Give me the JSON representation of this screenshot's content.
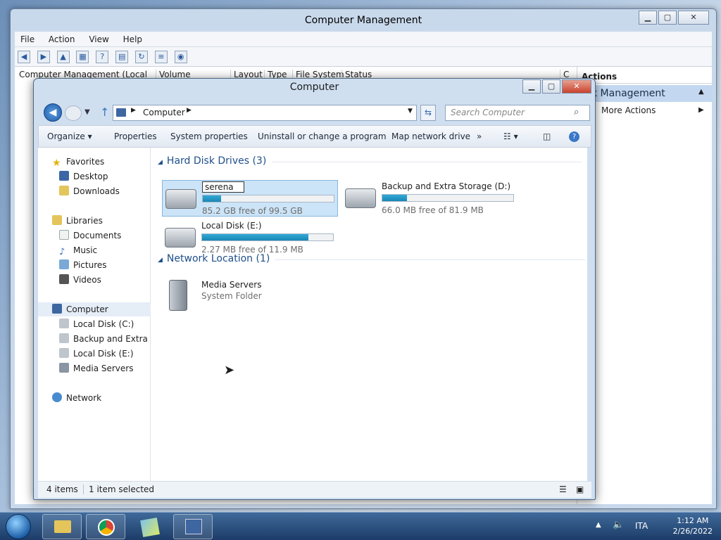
{
  "cm": {
    "title": "Computer Management",
    "menu": [
      "File",
      "Action",
      "View",
      "Help"
    ],
    "tree_root": "Computer Management (Local",
    "columns": [
      "Volume",
      "Layout",
      "Type",
      "File System",
      "Status",
      "C"
    ],
    "actions_header": "Actions",
    "actions_selected": "k Management",
    "more_actions": "More Actions"
  },
  "explorer": {
    "title": "Computer",
    "breadcrumb": "Computer",
    "search_placeholder": "Search Computer",
    "commands": [
      "Organize ▾",
      "Properties",
      "System properties",
      "Uninstall or change a program",
      "Map network drive",
      "»"
    ],
    "nav": {
      "favorites": "Favorites",
      "desktop": "Desktop",
      "downloads": "Downloads",
      "libraries": "Libraries",
      "documents": "Documents",
      "music": "Music",
      "pictures": "Pictures",
      "videos": "Videos",
      "computer": "Computer",
      "drive_c": "Local Disk (C:)",
      "drive_d": "Backup and Extra Sto",
      "drive_e": "Local Disk (E:)",
      "media_servers": "Media Servers",
      "network": "Network"
    },
    "hard_disk_group": "Hard Disk Drives (3)",
    "drives": [
      {
        "name": "serena",
        "free": "85.2 GB free of 99.5 GB",
        "used_fraction": 0.14
      },
      {
        "name": "Backup and Extra Storage (D:)",
        "free": "66.0 MB free of 81.9 MB",
        "used_fraction": 0.19
      },
      {
        "name": "Local Disk (E:)",
        "free": "2.27 MB free of 11.9 MB",
        "used_fraction": 0.81
      }
    ],
    "network_group": "Network Location (1)",
    "network_item": {
      "name": "Media Servers",
      "type": "System Folder"
    },
    "status_items": "4 items",
    "status_selected": "1 item selected"
  },
  "taskbar": {
    "lang": "ITA",
    "time": "1:12 AM",
    "date": "2/26/2022"
  },
  "colors": {
    "accent": "#1e4f8a",
    "bar_fill": "#2698c8",
    "selection": "#cce4f7"
  }
}
